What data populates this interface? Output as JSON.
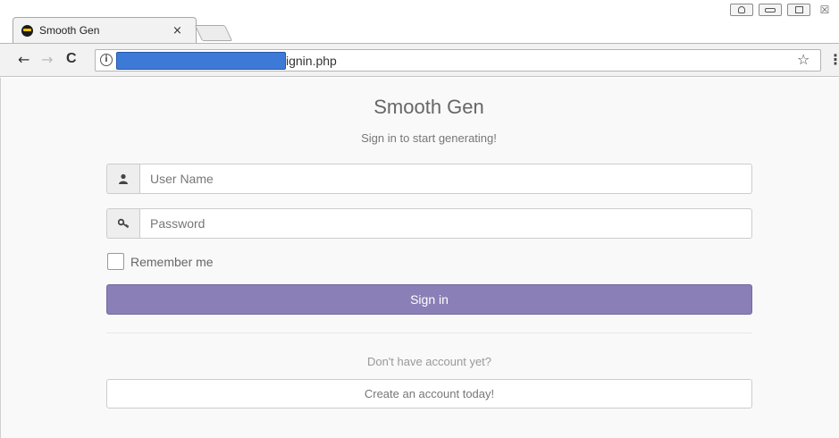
{
  "browser": {
    "tab_title": "Smooth Gen",
    "tab_close": "×",
    "url_suffix": "ignin.php",
    "info_glyph": "i",
    "back_glyph": "←",
    "forward_glyph": "→",
    "reload_glyph": "C",
    "star_glyph": "☆",
    "menu_glyph": "⋮",
    "window_close_glyph": "☒"
  },
  "page": {
    "brand": "Smooth Gen",
    "tagline": "Sign in to start generating!",
    "username_placeholder": "User Name",
    "password_placeholder": "Password",
    "remember_label": "Remember me",
    "signin_label": "Sign in",
    "no_account_text": "Don't have account yet?",
    "create_account_label": "Create an account today!"
  },
  "colors": {
    "signin_button": "#8a7fb6",
    "url_redaction": "#3d7ad8"
  },
  "icons": {
    "username": "user-icon",
    "password": "key-icon"
  }
}
